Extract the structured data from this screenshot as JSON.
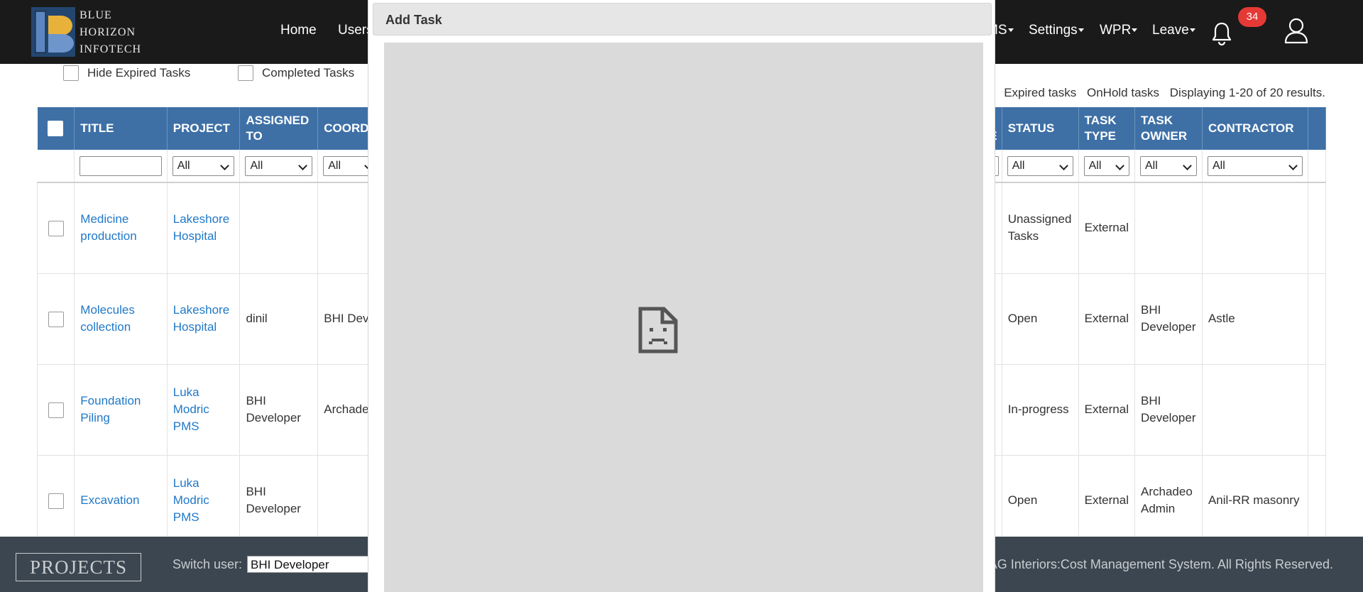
{
  "header": {
    "logo_lines": [
      "BLUE",
      "HORIZON",
      "INFOTECH"
    ],
    "nav": [
      {
        "label": "Home",
        "dropdown": false
      },
      {
        "label": "Users",
        "dropdown": true
      },
      {
        "label": "MS",
        "dropdown": true
      },
      {
        "label": "Settings",
        "dropdown": true
      },
      {
        "label": "WPR",
        "dropdown": true
      },
      {
        "label": "Leave",
        "dropdown": true
      }
    ],
    "notification_count": "34",
    "icons": {
      "bell": "bell-icon",
      "user": "user-icon"
    }
  },
  "toolbar": {
    "hide_expired_label": "Hide Expired Tasks",
    "completed_label": "Completed Tasks",
    "expired_tasks_link": "Expired tasks",
    "onhold_tasks_link": "OnHold tasks",
    "displaying_text": "Displaying 1-20 of 20 results."
  },
  "table": {
    "left_columns": [
      "TITLE",
      "PROJECT",
      "ASSIGNED TO",
      "COORD"
    ],
    "right_columns": [
      "D TE",
      "STATUS",
      "TASK TYPE",
      "TASK OWNER",
      "CONTRACTOR"
    ],
    "filter_all": "All",
    "rows": [
      {
        "title": "Medicine production",
        "project": "Lakeshore Hospital",
        "assigned_to": "",
        "coord": "",
        "date": "-",
        "status": "Unassigned Tasks",
        "task_type": "External",
        "task_owner": "",
        "contractor": ""
      },
      {
        "title": "Molecules collection",
        "project": "Lakeshore Hospital",
        "assigned_to": "dinil",
        "coord": "BHI Dev",
        "date": "-",
        "status": "Open",
        "task_type": "External",
        "task_owner": "BHI Developer",
        "contractor": "Astle"
      },
      {
        "title": "Foundation Piling",
        "project": "Luka Modric PMS",
        "assigned_to": "BHI Developer",
        "coord": "Archade",
        "date": "-",
        "status": "In-progress",
        "task_type": "External",
        "task_owner": "BHI Developer",
        "contractor": ""
      },
      {
        "title": "Excavation",
        "project": "Luka Modric PMS",
        "assigned_to": "BHI Developer",
        "coord": "",
        "date": "-",
        "status": "Open",
        "task_type": "External",
        "task_owner": "Archadeo Admin",
        "contractor": "Anil-RR masonry"
      }
    ]
  },
  "footer": {
    "brand": "PROJECTS",
    "switch_user_label": "Switch user:",
    "switch_user_value": "BHI Developer",
    "copyright": "AG Interiors:Cost Management System. All Rights Reserved."
  },
  "modal": {
    "title": "Add Task",
    "frame_icon": "sad-page-icon"
  },
  "colors": {
    "header_bg": "#1a1a1a",
    "table_header_bg": "#3e70a6",
    "link": "#1f78c8",
    "badge": "#e53935",
    "footer_bg": "#3b4650"
  }
}
